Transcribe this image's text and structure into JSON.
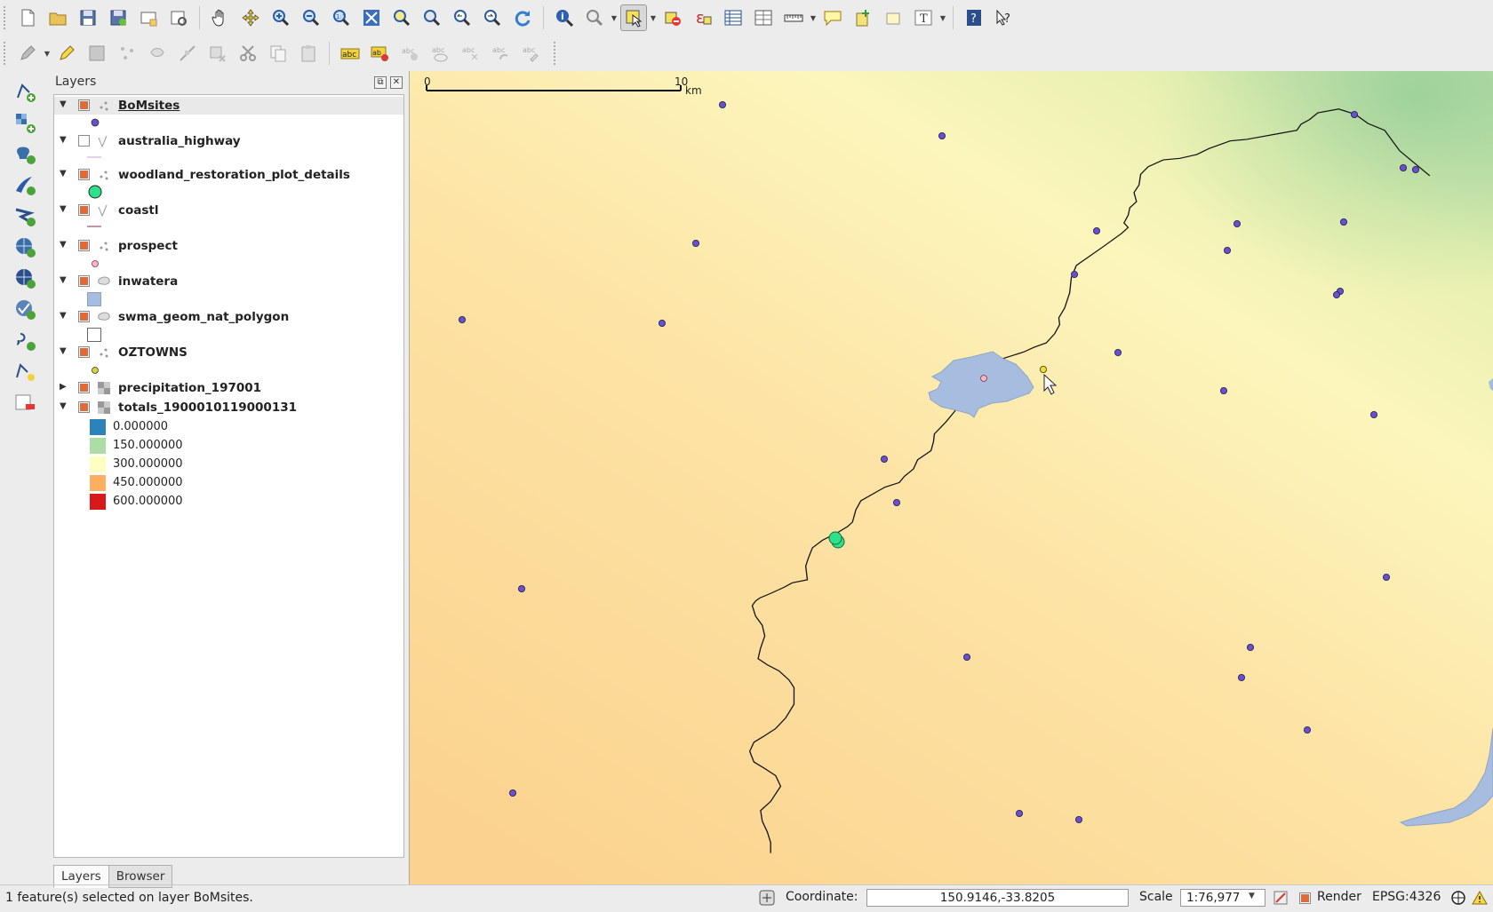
{
  "colors": {
    "site_point": "#6a4fd0",
    "check_on": "#e06a3a",
    "lake_fill": "#a6bddf",
    "selected_point": "#f2df2a"
  },
  "toolbar_top": {
    "icons": [
      "new-project-icon",
      "open-project-icon",
      "save-project-icon",
      "save-as-icon",
      "new-print-composer-icon",
      "composer-manager-icon",
      "pan-icon",
      "pan-to-selection-icon",
      "zoom-in-icon",
      "zoom-out-icon",
      "zoom-native-icon",
      "zoom-full-icon",
      "zoom-to-selection-icon",
      "zoom-to-layer-icon",
      "zoom-last-icon",
      "zoom-next-icon",
      "refresh-icon",
      "identify-icon",
      "map-tips-icon",
      "select-features-icon",
      "deselect-icon",
      "expression-select-icon",
      "attribute-table-icon",
      "statistics-icon",
      "measure-icon",
      "annotation-icon",
      "new-bookmark-icon",
      "show-bookmarks-icon",
      "text-annotation-icon",
      "help-icon",
      "whats-this-icon"
    ]
  },
  "toolbar_edit": {
    "icons": [
      "current-edits-icon",
      "toggle-editing-icon",
      "save-edits-icon",
      "digitize-icon",
      "move-feature-icon",
      "node-tool-icon",
      "delete-selected-icon",
      "cut-features-icon",
      "copy-features-icon",
      "paste-features-icon",
      "label-icon",
      "layer-labeling-icon",
      "pin-labels-icon",
      "show-hide-labels-icon",
      "move-label-icon",
      "rotate-label-icon",
      "change-label-icon"
    ]
  },
  "left_toolbar": {
    "icons": [
      "add-vector-layer-icon",
      "add-raster-layer-icon",
      "add-postgis-layer-icon",
      "add-spatialite-layer-icon",
      "add-mssql-layer-icon",
      "add-wms-layer-icon",
      "add-wcs-layer-icon",
      "add-wfs-layer-icon",
      "add-delimited-text-icon",
      "new-shapefile-icon",
      "remove-layer-icon"
    ]
  },
  "layers_panel": {
    "title": "Layers",
    "float_btn": "⧉",
    "close_btn": "✕",
    "layers": [
      {
        "name": "BoMsites",
        "checked": true,
        "type": "point",
        "expanded": true
      },
      {
        "name": "australia_highway",
        "checked": false,
        "type": "line",
        "expanded": true
      },
      {
        "name": "woodland_restoration_plot_details",
        "checked": true,
        "type": "point",
        "expanded": true
      },
      {
        "name": "coastl",
        "checked": true,
        "type": "line",
        "expanded": true
      },
      {
        "name": "prospect",
        "checked": true,
        "type": "point",
        "expanded": true
      },
      {
        "name": "inwatera",
        "checked": true,
        "type": "polygon",
        "expanded": true
      },
      {
        "name": "swma_geom_nat_polygon",
        "checked": true,
        "type": "polygon",
        "expanded": true
      },
      {
        "name": "OZTOWNS",
        "checked": true,
        "type": "point",
        "expanded": true
      },
      {
        "name": "precipitation_197001",
        "checked": true,
        "type": "raster",
        "expanded": false
      },
      {
        "name": "totals_1900010119000131",
        "checked": true,
        "type": "raster",
        "expanded": true
      }
    ],
    "legend": [
      {
        "label": "0.000000",
        "color": "#2b83ba"
      },
      {
        "label": "150.000000",
        "color": "#abdda4"
      },
      {
        "label": "300.000000",
        "color": "#ffffbf"
      },
      {
        "label": "450.000000",
        "color": "#fdae61"
      },
      {
        "label": "600.000000",
        "color": "#d7191c"
      }
    ],
    "tabs": {
      "layers": "Layers",
      "browser": "Browser"
    }
  },
  "map": {
    "scalebar": {
      "start": "0",
      "end": "10",
      "unit": "km"
    }
  },
  "statusbar": {
    "message": "1 feature(s) selected on layer BoMsites.",
    "coordinate_label": "Coordinate:",
    "coordinate_value": "150.9146,-33.8205",
    "scale_label": "Scale",
    "scale_value": "1:76,977",
    "render_label": "Render",
    "render_checked": true,
    "crs": "EPSG:4326"
  }
}
